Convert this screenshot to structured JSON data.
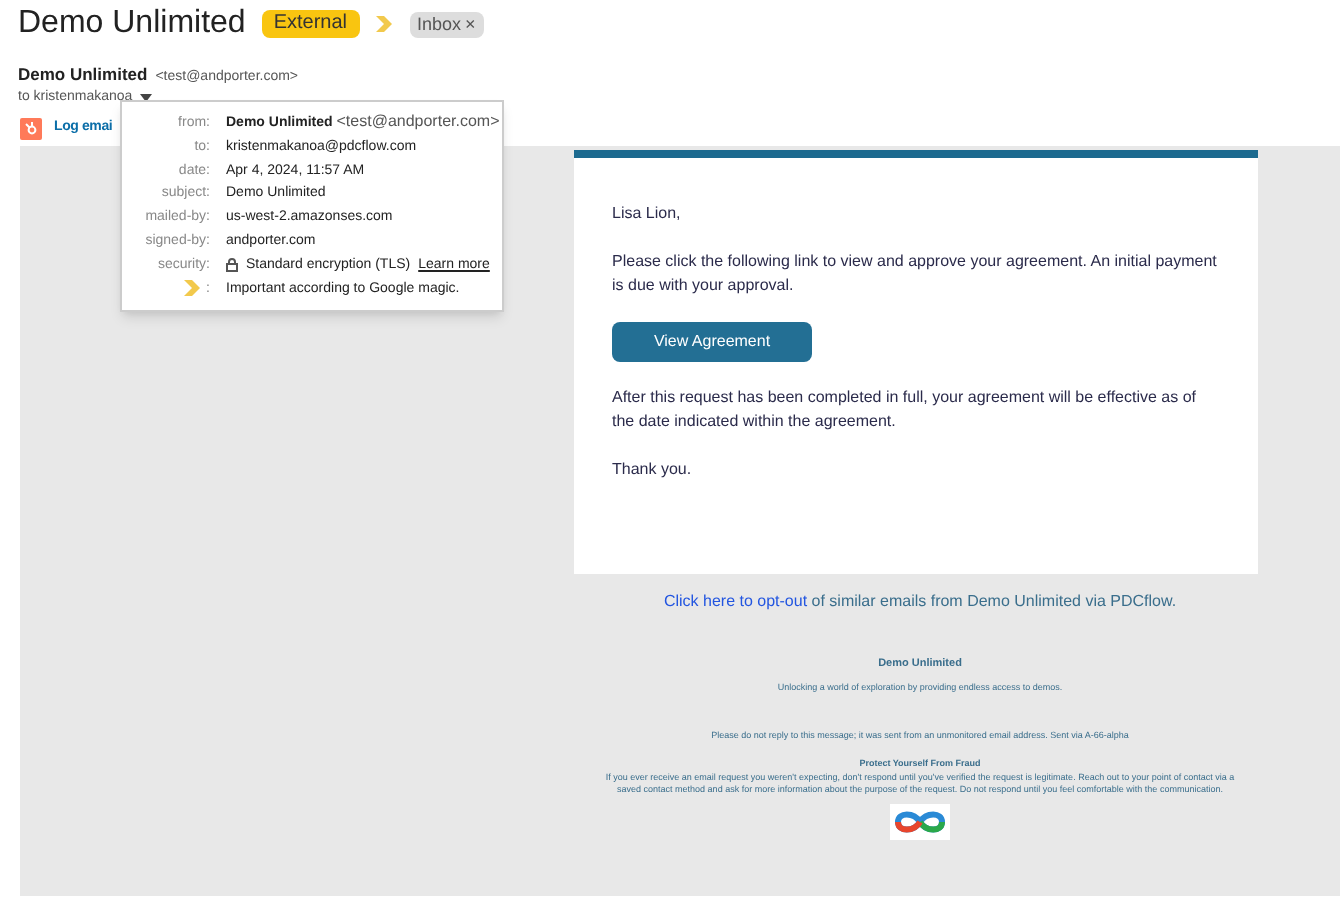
{
  "subject": "Demo Unlimited",
  "labels": [
    {
      "text": "External",
      "kind": "important"
    },
    {
      "text": "Inbox",
      "kind": "removable",
      "remove": "×"
    }
  ],
  "sender": {
    "name": "Demo Unlimited",
    "email": "<test@andporter.com>",
    "to": "to kristenmakanoa",
    "menu_open": true
  },
  "addon": {
    "label": "Log emai"
  },
  "details": [
    {
      "label": "from:",
      "name": "Demo Unlimited",
      "value": "<test@andporter.com>",
      "kind": "sender"
    },
    {
      "label": "to:",
      "value": "kristenmakanoa@pdcflow.com",
      "kind": "text"
    },
    {
      "label": "date:",
      "value": "Apr 4, 2024, 11:57 AM",
      "kind": "text"
    },
    {
      "label": "subject:",
      "value": "Demo Unlimited",
      "kind": "text"
    },
    {
      "label": "mailed-by:",
      "value": "us-west-2.amazonses.com",
      "kind": "text"
    },
    {
      "label": "signed-by:",
      "value": "andporter.com",
      "kind": "text"
    },
    {
      "label": "security:",
      "value": "Standard encryption (TLS)",
      "link": "Learn more",
      "kind": "security"
    },
    {
      "label": ":",
      "value": "Important according to Google magic.",
      "kind": "importance"
    }
  ],
  "email": {
    "greeting": "Lisa Lion,",
    "paragraph_1": "Please click the following link to view and approve your agreement. An initial payment is due with your approval.",
    "button": "View Agreement",
    "paragraph_2": "After this request has been completed in full, your agreement will be effective as of the date indicated within the agreement.",
    "closing": "Thank you."
  },
  "footer": {
    "optout_link": "Click here to opt-out",
    "optout_text": "of similar emails from Demo Unlimited via PDCflow.",
    "company": "Demo Unlimited",
    "tagline": "Unlocking a world of exploration by providing endless access to demos.",
    "notice": "Please do not reply to this message; it was sent from an unmonitored email address. Sent via A-66-alpha",
    "fraud_title": "Protect Yourself From Fraud",
    "fraud_text": "If you ever receive an email request you weren't expecting, don't respond until you've verified the request is legitimate. Reach out to your point of contact via a saved contact method and ask for more information about the purpose of the request. Do not respond until you feel comfortable with the communication."
  }
}
